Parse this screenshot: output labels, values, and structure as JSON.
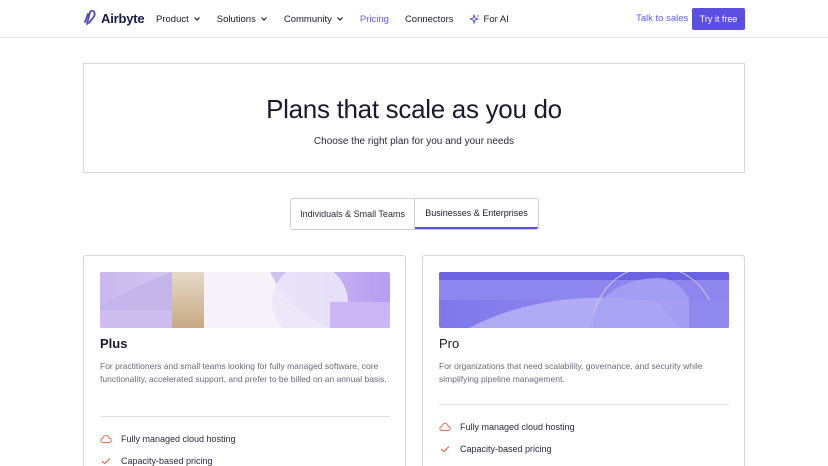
{
  "nav": {
    "brand": "Airbyte",
    "items": [
      {
        "label": "Product",
        "dropdown": true
      },
      {
        "label": "Solutions",
        "dropdown": true
      },
      {
        "label": "Community",
        "dropdown": true
      },
      {
        "label": "Pricing",
        "dropdown": false,
        "active": true
      },
      {
        "label": "Connectors",
        "dropdown": false
      },
      {
        "label": "For AI",
        "dropdown": false,
        "icon": "sparkle-icon"
      }
    ],
    "talk_label": "Talk to sales",
    "cta_label": "Try it free"
  },
  "hero": {
    "title": "Plans that scale as you do",
    "subtitle": "Choose the right plan for you and your needs"
  },
  "tabs": [
    {
      "label": "Individuals & Small Teams",
      "selected": false
    },
    {
      "label": "Businesses & Enterprises",
      "selected": true
    }
  ],
  "plans": [
    {
      "name": "Plus",
      "description": "For practitioners and small teams looking for fully managed software, core functionality, accelerated support, and prefer to be billed on an annual basis.",
      "features": [
        {
          "label": "Fully managed cloud hosting",
          "icon": "cloud-icon"
        },
        {
          "label": "Capacity-based pricing",
          "icon": "check-icon"
        }
      ]
    },
    {
      "name": "Pro",
      "description": "For organizations that need scalability, governance, and security while simplifying pipeline management.",
      "features": [
        {
          "label": "Fully managed cloud hosting",
          "icon": "cloud-icon"
        },
        {
          "label": "Capacity-based pricing",
          "icon": "check-icon"
        }
      ]
    }
  ],
  "colors": {
    "accent": "#5b4fe0",
    "link": "#615eff",
    "feature_icon": "#e8735a"
  }
}
